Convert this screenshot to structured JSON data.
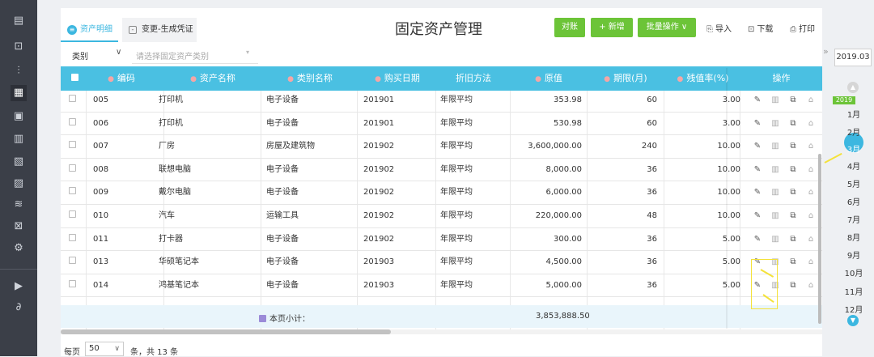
{
  "tabs": [
    {
      "label": "资产明细",
      "icon": "asset-detail-icon",
      "active": true
    },
    {
      "label": "变更-生成凭证",
      "icon": "voucher-icon",
      "active": false
    }
  ],
  "page_title": "固定资产管理",
  "toolbar": {
    "reconcile_label": "对账",
    "add_label": "+ 新增",
    "batch_label": "批量操作 ∨",
    "import_label": "导入",
    "download_label": "下载",
    "print_label": "打印"
  },
  "filter": {
    "category_label": "类别",
    "category_placeholder": "请选择固定资产类别"
  },
  "columns": [
    "编码",
    "资产名称",
    "类别名称",
    "购买日期",
    "折旧方法",
    "原值",
    "期限(月)",
    "残值率(%)",
    "操作"
  ],
  "rows": [
    {
      "code": "005",
      "name": "打印机",
      "category": "电子设备",
      "date": "201901",
      "method": "年限平均",
      "value": "353.98",
      "term": "60",
      "residual": "3.00"
    },
    {
      "code": "006",
      "name": "打印机",
      "category": "电子设备",
      "date": "201901",
      "method": "年限平均",
      "value": "530.98",
      "term": "60",
      "residual": "3.00"
    },
    {
      "code": "007",
      "name": "厂房",
      "category": "房屋及建筑物",
      "date": "201902",
      "method": "年限平均",
      "value": "3,600,000.00",
      "term": "240",
      "residual": "10.00"
    },
    {
      "code": "008",
      "name": "联想电脑",
      "category": "电子设备",
      "date": "201902",
      "method": "年限平均",
      "value": "8,000.00",
      "term": "36",
      "residual": "10.00"
    },
    {
      "code": "009",
      "name": "戴尔电脑",
      "category": "电子设备",
      "date": "201902",
      "method": "年限平均",
      "value": "6,000.00",
      "term": "36",
      "residual": "10.00"
    },
    {
      "code": "010",
      "name": "汽车",
      "category": "运输工具",
      "date": "201902",
      "method": "年限平均",
      "value": "220,000.00",
      "term": "48",
      "residual": "10.00"
    },
    {
      "code": "011",
      "name": "打卡器",
      "category": "电子设备",
      "date": "201902",
      "method": "年限平均",
      "value": "300.00",
      "term": "36",
      "residual": "5.00"
    },
    {
      "code": "013",
      "name": "华硕笔记本",
      "category": "电子设备",
      "date": "201903",
      "method": "年限平均",
      "value": "4,500.00",
      "term": "36",
      "residual": "5.00"
    },
    {
      "code": "014",
      "name": "鸿基笔记本",
      "category": "电子设备",
      "date": "201903",
      "method": "年限平均",
      "value": "5,000.00",
      "term": "36",
      "residual": "5.00"
    }
  ],
  "subtotal": {
    "label": "本页小计：",
    "value": "3,853,888.50"
  },
  "pagination": {
    "per_page_label": "每页",
    "per_page_value": "50",
    "total_text": "条，共 13 条"
  },
  "right_panel": {
    "year_value": "2019.03",
    "year_badge": "2019",
    "months": [
      "1月",
      "2月",
      "3月",
      "4月",
      "5月",
      "6月",
      "7月",
      "8月",
      "9月",
      "10月",
      "11月",
      "12月"
    ],
    "active_month": "3月"
  },
  "colors": {
    "accent": "#4ac0e2",
    "green": "#6cc438",
    "sidebar": "#3b3f48",
    "highlight": "#f4e23a"
  }
}
